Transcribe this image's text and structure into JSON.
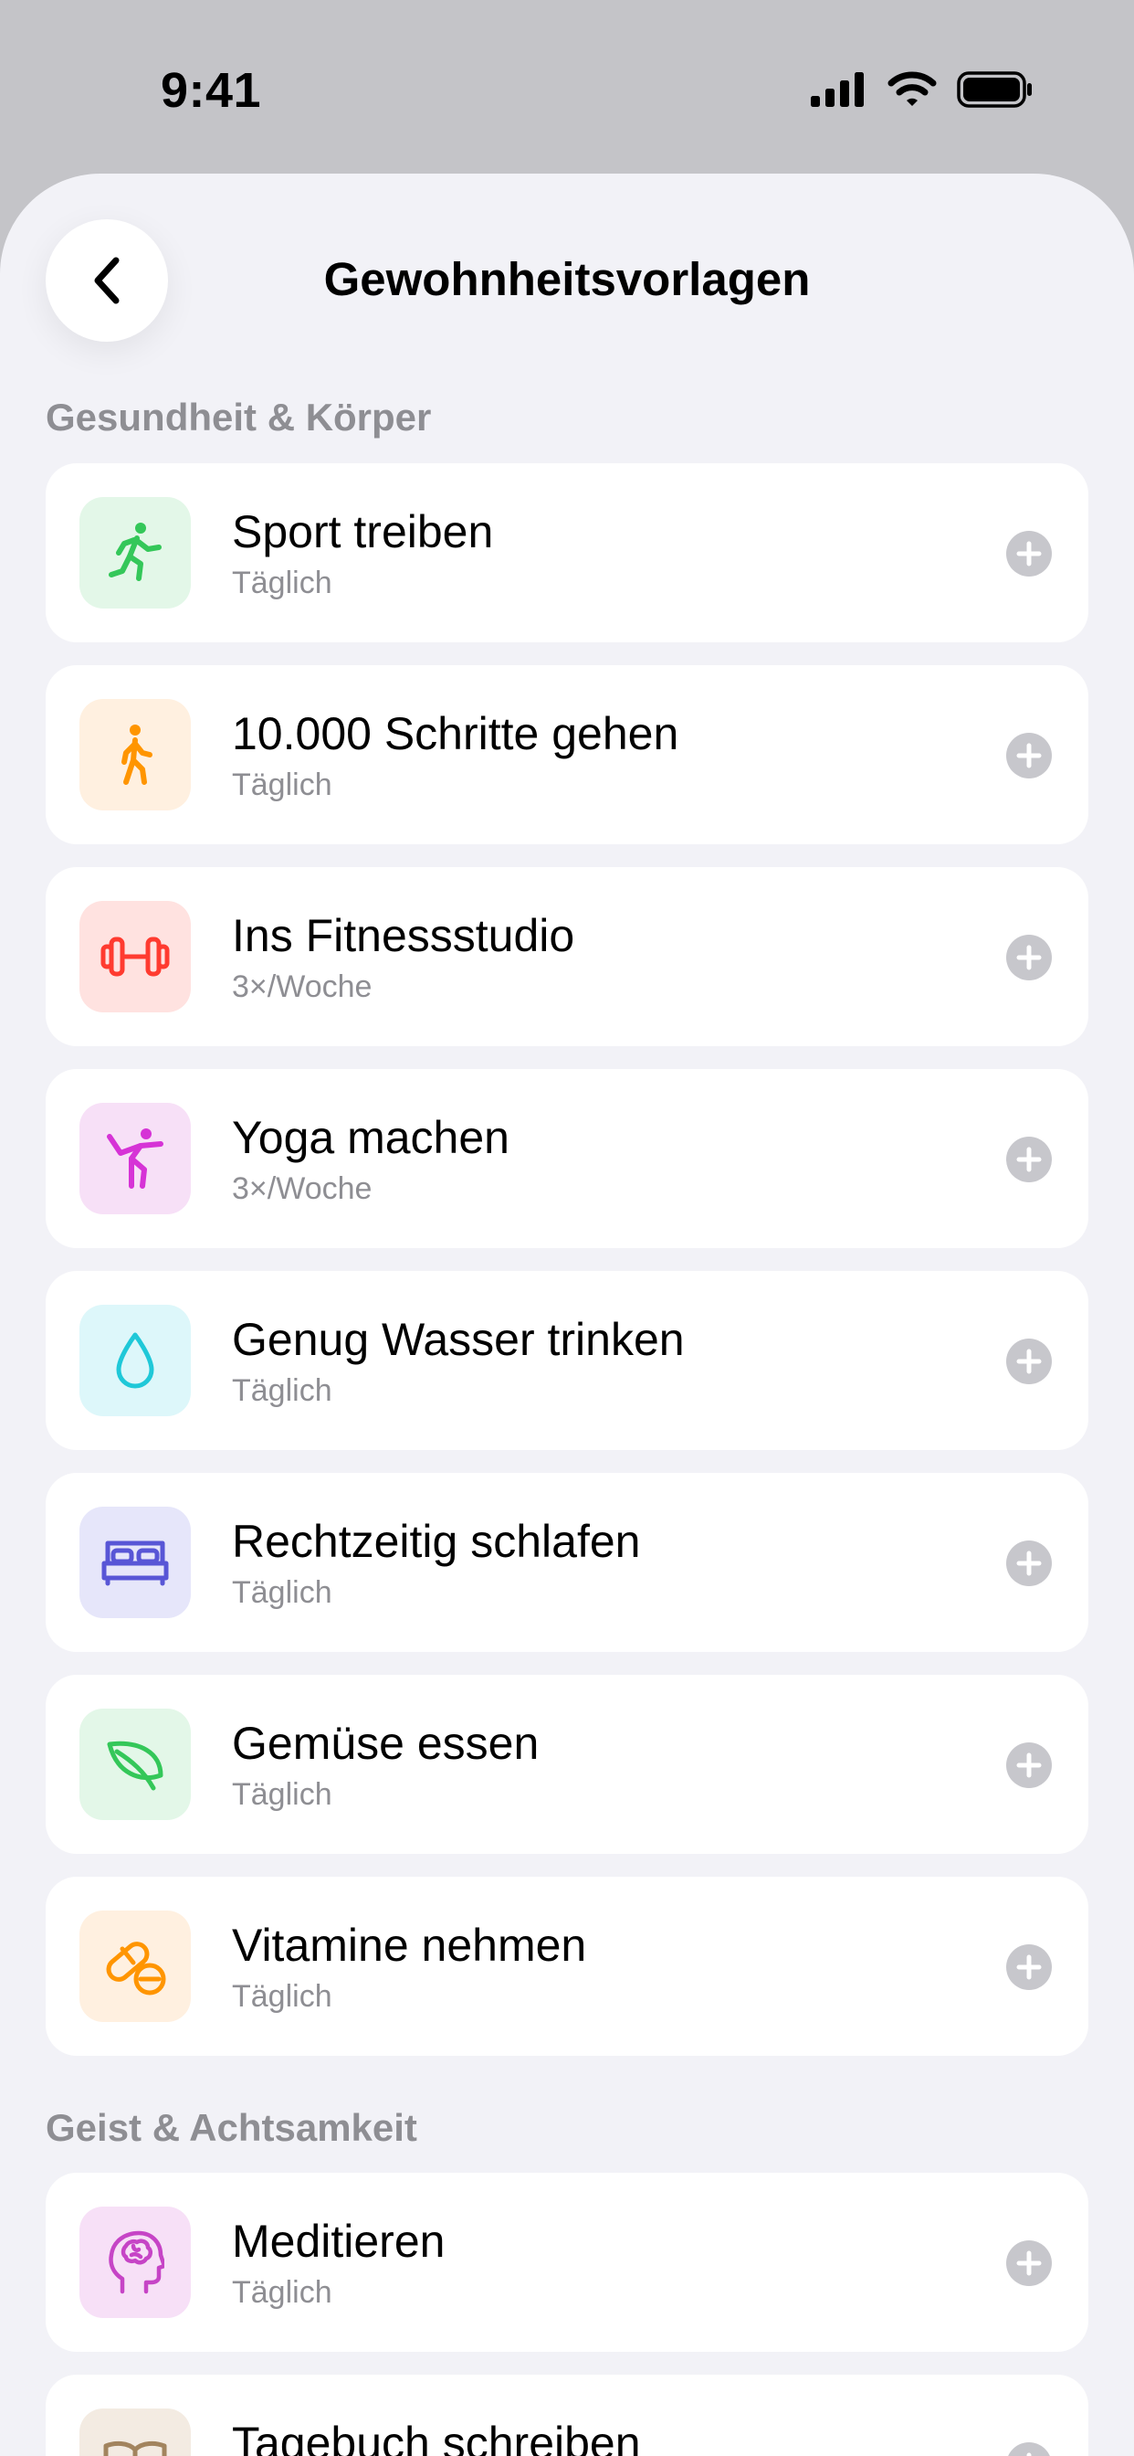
{
  "status": {
    "time": "9:41"
  },
  "header": {
    "title": "Gewohnheitsvorlagen"
  },
  "sections": [
    {
      "title": "Gesundheit & Körper",
      "items": [
        {
          "title": "Sport treiben",
          "subtitle": "Täglich",
          "icon": "running-icon",
          "color": "#34c759",
          "bg": "#e3f7e8"
        },
        {
          "title": "10.000 Schritte gehen",
          "subtitle": "Täglich",
          "icon": "walking-icon",
          "color": "#ff9500",
          "bg": "#fff0e0"
        },
        {
          "title": "Ins Fitnessstudio",
          "subtitle": "3×/Woche",
          "icon": "dumbbell-icon",
          "color": "#ff3b30",
          "bg": "#ffe2e0"
        },
        {
          "title": "Yoga machen",
          "subtitle": "3×/Woche",
          "icon": "yoga-icon",
          "color": "#d633d6",
          "bg": "#f7e0f7"
        },
        {
          "title": "Genug Wasser trinken",
          "subtitle": "Täglich",
          "icon": "water-drop-icon",
          "color": "#1fc8d8",
          "bg": "#ddf7fa"
        },
        {
          "title": "Rechtzeitig schlafen",
          "subtitle": "Täglich",
          "icon": "bed-icon",
          "color": "#5856d6",
          "bg": "#e6e6fa"
        },
        {
          "title": "Gemüse essen",
          "subtitle": "Täglich",
          "icon": "leaf-icon",
          "color": "#34c759",
          "bg": "#e3f7e8"
        },
        {
          "title": "Vitamine nehmen",
          "subtitle": "Täglich",
          "icon": "pills-icon",
          "color": "#ff9500",
          "bg": "#fff0e0"
        }
      ]
    },
    {
      "title": "Geist & Achtsamkeit",
      "items": [
        {
          "title": "Meditieren",
          "subtitle": "Täglich",
          "icon": "brain-head-icon",
          "color": "#c644c6",
          "bg": "#f7e0f7"
        },
        {
          "title": "Tagebuch schreiben",
          "subtitle": "",
          "icon": "book-icon",
          "color": "#a2845e",
          "bg": "#f3ebe2"
        }
      ]
    }
  ]
}
